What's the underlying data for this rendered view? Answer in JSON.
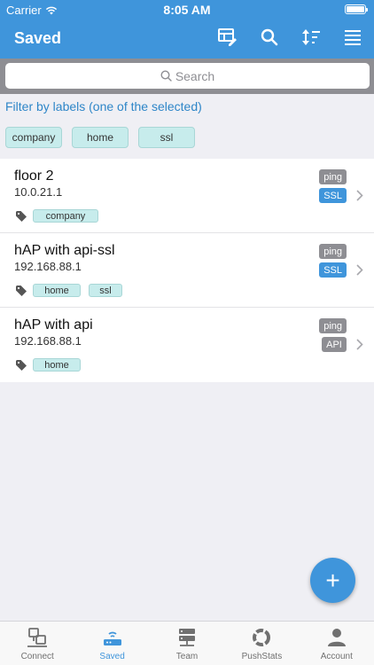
{
  "status_bar": {
    "carrier": "Carrier",
    "time": "8:05 AM"
  },
  "nav": {
    "title": "Saved"
  },
  "search": {
    "placeholder": "Search"
  },
  "filter": {
    "title": "Filter by labels (one of the selected)",
    "labels": [
      "company",
      "home",
      "ssl"
    ]
  },
  "devices": [
    {
      "name": "floor 2",
      "ip": "10.0.21.1",
      "tags": [
        "company"
      ],
      "badges": [
        "ping",
        "SSL"
      ]
    },
    {
      "name": "hAP with api-ssl",
      "ip": "192.168.88.1",
      "tags": [
        "home",
        "ssl"
      ],
      "badges": [
        "ping",
        "SSL"
      ]
    },
    {
      "name": "hAP with api",
      "ip": "192.168.88.1",
      "tags": [
        "home"
      ],
      "badges": [
        "ping",
        "API"
      ]
    }
  ],
  "fab": {
    "label": "+"
  },
  "tabs": [
    {
      "label": "Connect",
      "icon": "connect-icon"
    },
    {
      "label": "Saved",
      "icon": "saved-router-icon"
    },
    {
      "label": "Team",
      "icon": "team-server-icon"
    },
    {
      "label": "PushStats",
      "icon": "pushstats-icon"
    },
    {
      "label": "Account",
      "icon": "account-icon"
    }
  ],
  "colors": {
    "accent": "#3f95db",
    "chip": "#c7ecec",
    "badge_gray": "#8e8e93"
  }
}
